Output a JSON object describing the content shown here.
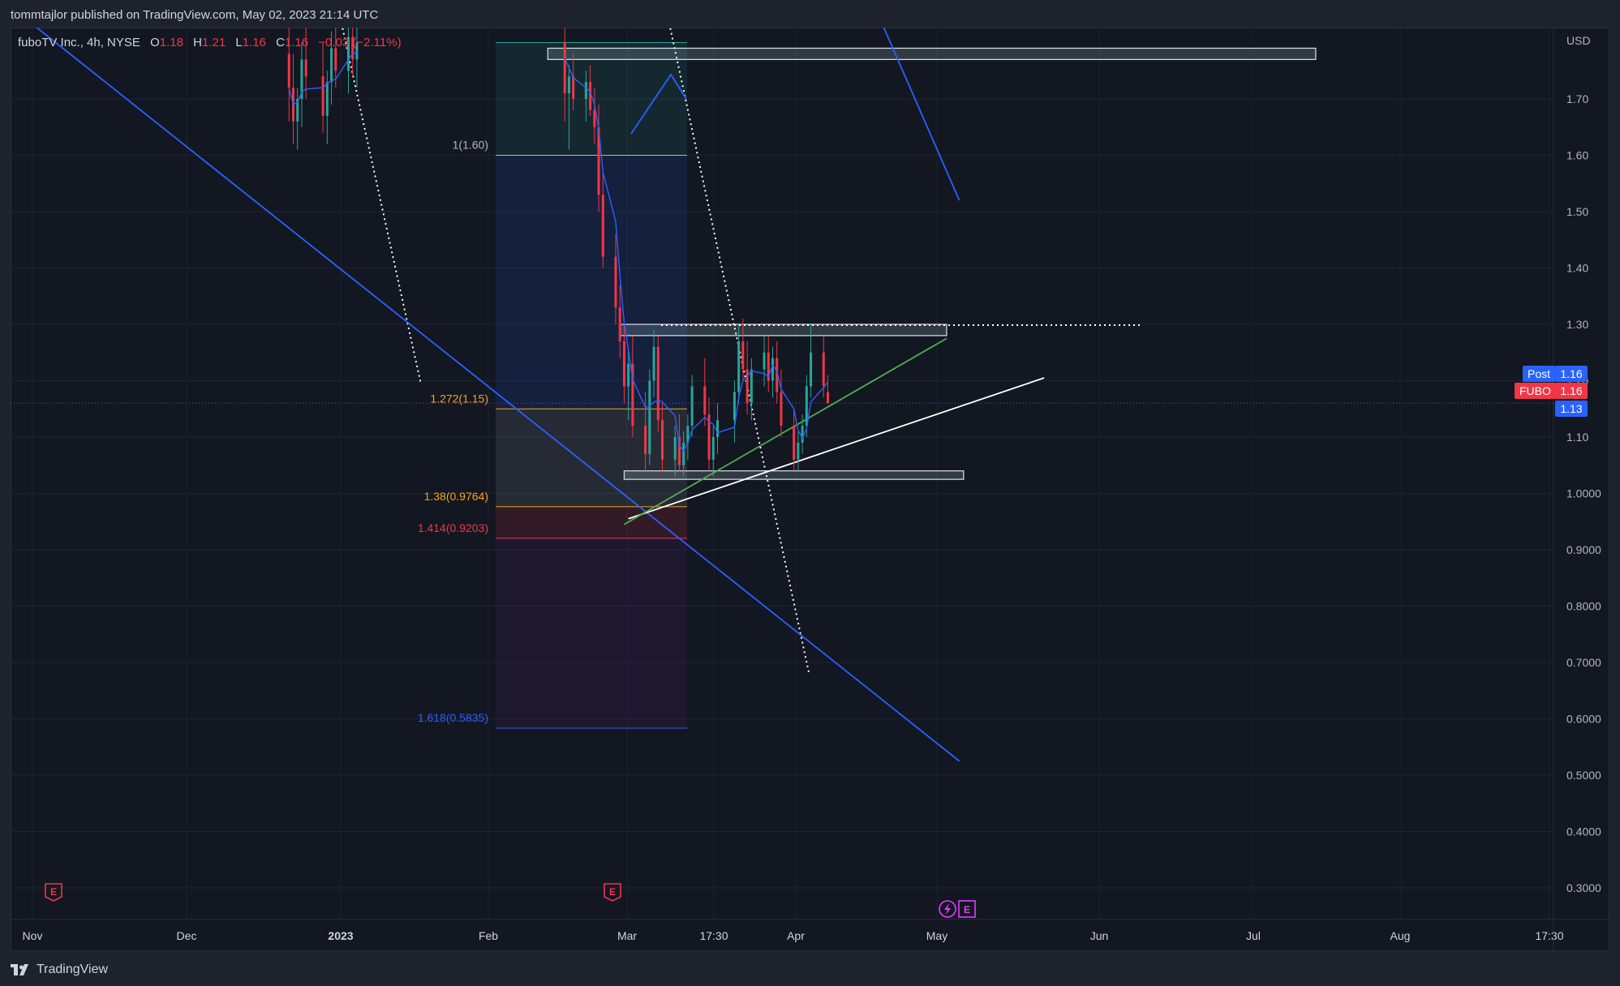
{
  "header": {
    "published_text": "tommtajlor published on TradingView.com, May 02, 2023 21:14 UTC"
  },
  "legend": {
    "symbol_name": "fuboTV Inc., 4h, NYSE",
    "open_label": "O",
    "open_value": "1.18",
    "high_label": "H",
    "high_value": "1.21",
    "low_label": "L",
    "low_value": "1.16",
    "close_label": "C",
    "close_value": "1.16",
    "change_value": "−0.03 (−2.11%)"
  },
  "price_axis": {
    "currency": "USD",
    "ticks": [
      "1.70",
      "1.60",
      "1.50",
      "1.40",
      "1.30",
      "1.20",
      "1.10",
      "1.0000",
      "0.9000",
      "0.8000",
      "0.7000",
      "0.6000",
      "0.5000",
      "0.4000",
      "0.3000"
    ],
    "tick_values": [
      1.7,
      1.6,
      1.5,
      1.4,
      1.3,
      1.2,
      1.1,
      1.0,
      0.9,
      0.8,
      0.7,
      0.6,
      0.5,
      0.4,
      0.3
    ]
  },
  "time_axis": {
    "labels": [
      "Nov",
      "Dec",
      "2023",
      "Feb",
      "Mar",
      "17:30",
      "Apr",
      "May",
      "Jun",
      "Jul",
      "Aug",
      "17:30"
    ]
  },
  "price_tags": {
    "post_label": "Post",
    "post_value": "1.16",
    "symbol_label": "FUBO",
    "symbol_value": "1.16",
    "ma_value": "1.13"
  },
  "colors": {
    "background": "#131722",
    "up": "#26a69a",
    "down": "#f23645",
    "trendline_blue": "#2962ff",
    "support_white": "#ffffff",
    "trend_green": "#4caf50",
    "fib_orange": "#f7a21b",
    "fib_red": "#f23645",
    "fib_blue": "#2962ff",
    "fib_gray": "#b2b5be"
  },
  "events": {
    "earnings_label": "E",
    "dividend_icon": "lightning-icon"
  },
  "footer": {
    "brand": "TradingView"
  },
  "chart_data": {
    "type": "candlestick",
    "symbol": "FUBO",
    "timeframe": "4h",
    "x_range": [
      "2022-10-25",
      "2023-08-31"
    ],
    "y_range": [
      0.22,
      1.82
    ],
    "last_price": 1.16,
    "moving_average_last": 1.13,
    "fib_levels": [
      {
        "label": "1(1.60)",
        "ratio": 1.0,
        "price": 1.6
      },
      {
        "label": "1.272(1.15)",
        "ratio": 1.272,
        "price": 1.15
      },
      {
        "label": "1.38(0.9764)",
        "ratio": 1.38,
        "price": 0.9764
      },
      {
        "label": "1.414(0.9203)",
        "ratio": 1.414,
        "price": 0.9203
      },
      {
        "label": "1.618(0.5835)",
        "ratio": 1.618,
        "price": 0.5835
      }
    ],
    "zones": [
      {
        "name": "resistance-zone",
        "from": "2023-03-14",
        "to": "2023-05-30",
        "low": 1.28,
        "high": 1.3
      },
      {
        "name": "support-zone",
        "from": "2023-03-15",
        "to": "2023-06-03",
        "low": 1.025,
        "high": 1.04
      },
      {
        "name": "top-zone",
        "from": "2023-02-25",
        "to": "2023-08-25",
        "low": 1.77,
        "high": 1.79
      }
    ],
    "trendlines": [
      {
        "name": "long-downtrend",
        "from": [
          "2022-10-27",
          1.83
        ],
        "to": [
          "2023-06-02",
          0.525
        ]
      },
      {
        "name": "upper-downtrend",
        "from": [
          "2023-05-15",
          1.83
        ],
        "to": [
          "2023-06-02",
          1.52
        ]
      },
      {
        "name": "white-support",
        "from": [
          "2023-03-16",
          0.955
        ],
        "to": [
          "2023-06-22",
          1.205
        ]
      },
      {
        "name": "green-support",
        "from": [
          "2023-03-15",
          0.945
        ],
        "to": [
          "2023-05-30",
          1.275
        ]
      }
    ],
    "candles": [
      {
        "t": "2022-12-26",
        "o": 1.78,
        "h": 1.83,
        "l": 1.66,
        "c": 1.72
      },
      {
        "t": "2022-12-27",
        "o": 1.72,
        "h": 1.78,
        "l": 1.62,
        "c": 1.66
      },
      {
        "t": "2022-12-28",
        "o": 1.66,
        "h": 1.72,
        "l": 1.61,
        "c": 1.7
      },
      {
        "t": "2022-12-29",
        "o": 1.7,
        "h": 1.8,
        "l": 1.65,
        "c": 1.77
      },
      {
        "t": "2022-12-30",
        "o": 1.77,
        "h": 1.83,
        "l": 1.7,
        "c": 1.74
      },
      {
        "t": "2023-01-03",
        "o": 1.74,
        "h": 1.8,
        "l": 1.64,
        "c": 1.67
      },
      {
        "t": "2023-01-04",
        "o": 1.67,
        "h": 1.75,
        "l": 1.62,
        "c": 1.73
      },
      {
        "t": "2023-01-05",
        "o": 1.73,
        "h": 1.82,
        "l": 1.69,
        "c": 1.79
      },
      {
        "t": "2023-01-06",
        "o": 1.79,
        "h": 1.83,
        "l": 1.72,
        "c": 1.75
      },
      {
        "t": "2023-01-09",
        "o": 1.75,
        "h": 1.83,
        "l": 1.71,
        "c": 1.81
      },
      {
        "t": "2023-01-10",
        "o": 1.81,
        "h": 1.83,
        "l": 1.74,
        "c": 1.77
      },
      {
        "t": "2023-01-11",
        "o": 1.77,
        "h": 1.83,
        "l": 1.72,
        "c": 1.8
      },
      {
        "t": "2023-03-01",
        "o": 1.8,
        "h": 1.83,
        "l": 1.66,
        "c": 1.71
      },
      {
        "t": "2023-03-02",
        "o": 1.71,
        "h": 1.76,
        "l": 1.61,
        "c": 1.74
      },
      {
        "t": "2023-03-03",
        "o": 1.74,
        "h": 1.78,
        "l": 1.68,
        "c": 1.7
      },
      {
        "t": "2023-03-06",
        "o": 1.7,
        "h": 1.75,
        "l": 1.66,
        "c": 1.73
      },
      {
        "t": "2023-03-07",
        "o": 1.73,
        "h": 1.76,
        "l": 1.67,
        "c": 1.68
      },
      {
        "t": "2023-03-08",
        "o": 1.68,
        "h": 1.72,
        "l": 1.62,
        "c": 1.65
      },
      {
        "t": "2023-03-09",
        "o": 1.65,
        "h": 1.69,
        "l": 1.5,
        "c": 1.53
      },
      {
        "t": "2023-03-10",
        "o": 1.53,
        "h": 1.57,
        "l": 1.4,
        "c": 1.42
      },
      {
        "t": "2023-03-13",
        "o": 1.42,
        "h": 1.46,
        "l": 1.3,
        "c": 1.33
      },
      {
        "t": "2023-03-14",
        "o": 1.33,
        "h": 1.37,
        "l": 1.24,
        "c": 1.27
      },
      {
        "t": "2023-03-15",
        "o": 1.27,
        "h": 1.31,
        "l": 1.16,
        "c": 1.19
      },
      {
        "t": "2023-03-16",
        "o": 1.19,
        "h": 1.26,
        "l": 1.13,
        "c": 1.23
      },
      {
        "t": "2023-03-17",
        "o": 1.23,
        "h": 1.28,
        "l": 1.1,
        "c": 1.12
      },
      {
        "t": "2023-03-20",
        "o": 1.12,
        "h": 1.18,
        "l": 1.04,
        "c": 1.07
      },
      {
        "t": "2023-03-21",
        "o": 1.07,
        "h": 1.22,
        "l": 1.05,
        "c": 1.2
      },
      {
        "t": "2023-03-22",
        "o": 1.2,
        "h": 1.29,
        "l": 1.17,
        "c": 1.26
      },
      {
        "t": "2023-03-23",
        "o": 1.26,
        "h": 1.28,
        "l": 1.11,
        "c": 1.13
      },
      {
        "t": "2023-03-24",
        "o": 1.13,
        "h": 1.16,
        "l": 1.04,
        "c": 1.06
      },
      {
        "t": "2023-03-27",
        "o": 1.06,
        "h": 1.12,
        "l": 1.03,
        "c": 1.1
      },
      {
        "t": "2023-03-28",
        "o": 1.1,
        "h": 1.14,
        "l": 1.04,
        "c": 1.05
      },
      {
        "t": "2023-03-29",
        "o": 1.05,
        "h": 1.11,
        "l": 1.03,
        "c": 1.09
      },
      {
        "t": "2023-03-30",
        "o": 1.09,
        "h": 1.14,
        "l": 1.06,
        "c": 1.12
      },
      {
        "t": "2023-03-31",
        "o": 1.12,
        "h": 1.21,
        "l": 1.1,
        "c": 1.19
      },
      {
        "t": "2023-04-03",
        "o": 1.19,
        "h": 1.24,
        "l": 1.12,
        "c": 1.14
      },
      {
        "t": "2023-04-04",
        "o": 1.14,
        "h": 1.17,
        "l": 1.04,
        "c": 1.06
      },
      {
        "t": "2023-04-05",
        "o": 1.06,
        "h": 1.12,
        "l": 1.03,
        "c": 1.1
      },
      {
        "t": "2023-04-06",
        "o": 1.1,
        "h": 1.16,
        "l": 1.07,
        "c": 1.13
      },
      {
        "t": "2023-04-10",
        "o": 1.13,
        "h": 1.2,
        "l": 1.09,
        "c": 1.18
      },
      {
        "t": "2023-04-11",
        "o": 1.18,
        "h": 1.3,
        "l": 1.16,
        "c": 1.27
      },
      {
        "t": "2023-04-12",
        "o": 1.27,
        "h": 1.31,
        "l": 1.2,
        "c": 1.22
      },
      {
        "t": "2023-04-13",
        "o": 1.22,
        "h": 1.27,
        "l": 1.14,
        "c": 1.16
      },
      {
        "t": "2023-04-14",
        "o": 1.16,
        "h": 1.24,
        "l": 1.13,
        "c": 1.22
      },
      {
        "t": "2023-04-17",
        "o": 1.22,
        "h": 1.28,
        "l": 1.19,
        "c": 1.25
      },
      {
        "t": "2023-04-18",
        "o": 1.25,
        "h": 1.28,
        "l": 1.18,
        "c": 1.2
      },
      {
        "t": "2023-04-19",
        "o": 1.2,
        "h": 1.26,
        "l": 1.17,
        "c": 1.24
      },
      {
        "t": "2023-04-20",
        "o": 1.24,
        "h": 1.27,
        "l": 1.16,
        "c": 1.18
      },
      {
        "t": "2023-04-21",
        "o": 1.18,
        "h": 1.22,
        "l": 1.1,
        "c": 1.12
      },
      {
        "t": "2023-04-24",
        "o": 1.12,
        "h": 1.15,
        "l": 1.04,
        "c": 1.06
      },
      {
        "t": "2023-04-25",
        "o": 1.06,
        "h": 1.11,
        "l": 1.04,
        "c": 1.09
      },
      {
        "t": "2023-04-26",
        "o": 1.09,
        "h": 1.14,
        "l": 1.07,
        "c": 1.12
      },
      {
        "t": "2023-04-27",
        "o": 1.12,
        "h": 1.21,
        "l": 1.1,
        "c": 1.19
      },
      {
        "t": "2023-04-28",
        "o": 1.19,
        "h": 1.3,
        "l": 1.17,
        "c": 1.25
      },
      {
        "t": "2023-05-01",
        "o": 1.25,
        "h": 1.28,
        "l": 1.17,
        "c": 1.19
      },
      {
        "t": "2023-05-02",
        "o": 1.18,
        "h": 1.21,
        "l": 1.16,
        "c": 1.16
      }
    ]
  }
}
